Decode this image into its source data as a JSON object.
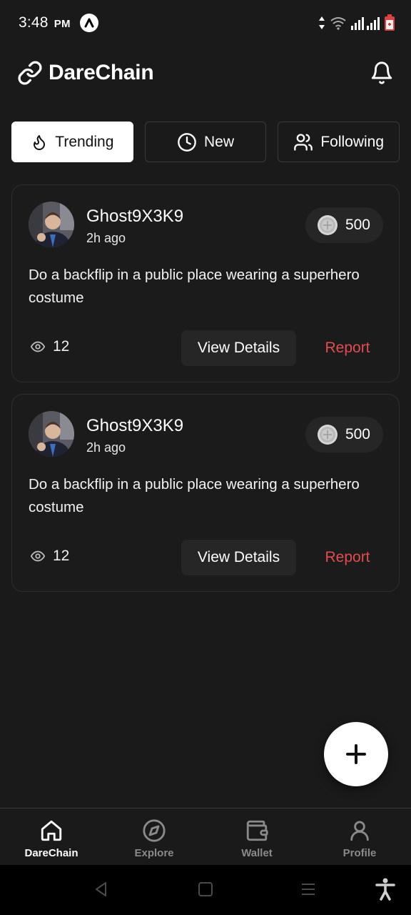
{
  "status": {
    "time": "3:48",
    "ampm": "PM"
  },
  "header": {
    "title": "DareChain"
  },
  "tabs": [
    {
      "label": "Trending",
      "icon": "flame-icon",
      "active": true
    },
    {
      "label": "New",
      "icon": "clock-icon",
      "active": false
    },
    {
      "label": "Following",
      "icon": "users-icon",
      "active": false
    }
  ],
  "posts": [
    {
      "username": "Ghost9X3K9",
      "time_ago": "2h ago",
      "reward": "500",
      "dare": "Do a backflip in a public place wearing a superhero costume",
      "views": "12",
      "details_label": "View Details",
      "report_label": "Report"
    },
    {
      "username": "Ghost9X3K9",
      "time_ago": "2h ago",
      "reward": "500",
      "dare": "Do a backflip in a public place wearing a superhero costume",
      "views": "12",
      "details_label": "View Details",
      "report_label": "Report"
    }
  ],
  "nav": [
    {
      "label": "DareChain",
      "icon": "home-icon",
      "active": true
    },
    {
      "label": "Explore",
      "icon": "compass-icon",
      "active": false
    },
    {
      "label": "Wallet",
      "icon": "wallet-icon",
      "active": false
    },
    {
      "label": "Profile",
      "icon": "user-icon",
      "active": false
    }
  ],
  "colors": {
    "background": "#1a1a1a",
    "report": "#e34c4c",
    "card_border": "#2e2e2e"
  }
}
